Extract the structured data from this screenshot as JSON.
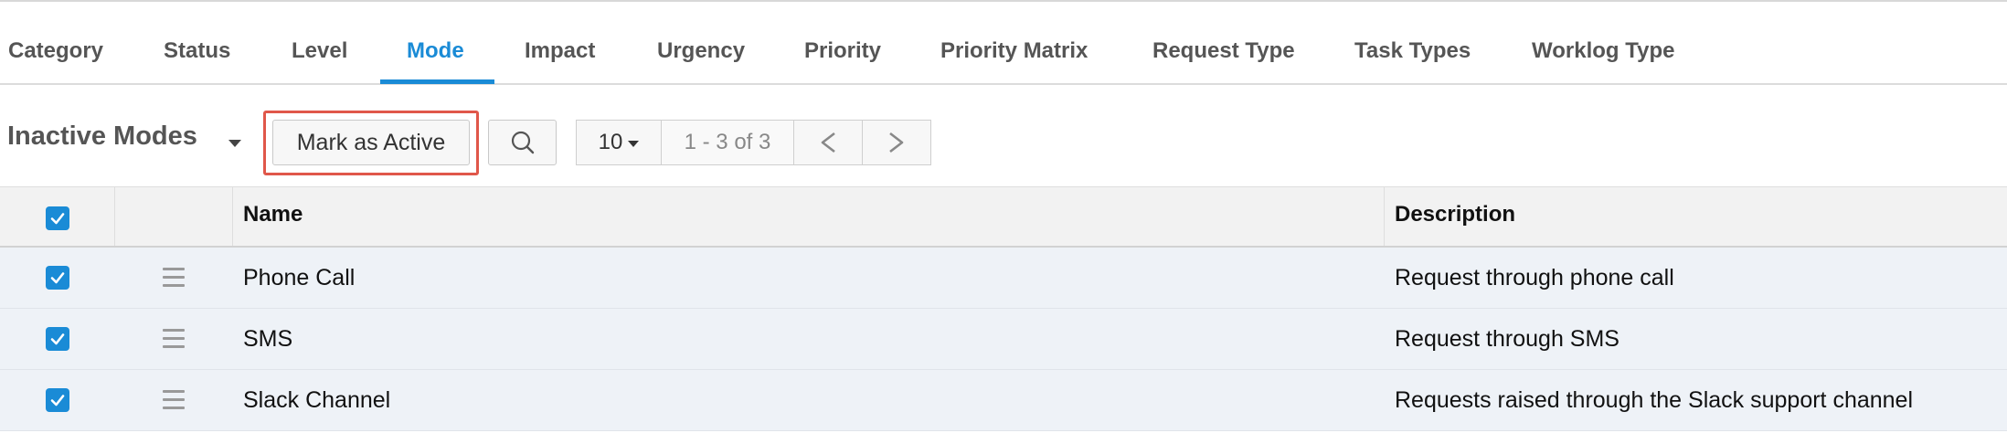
{
  "tabs": [
    {
      "label": "Category"
    },
    {
      "label": "Status"
    },
    {
      "label": "Level"
    },
    {
      "label": "Mode"
    },
    {
      "label": "Impact"
    },
    {
      "label": "Urgency"
    },
    {
      "label": "Priority"
    },
    {
      "label": "Priority Matrix"
    },
    {
      "label": "Request Type"
    },
    {
      "label": "Task Types"
    },
    {
      "label": "Worklog Type"
    }
  ],
  "active_tab": "Mode",
  "toolbar": {
    "view_title": "Inactive Modes",
    "mark_active_label": "Mark as Active",
    "search_icon": "search-icon",
    "page_size": "10",
    "page_info": "1 - 3 of 3",
    "prev_icon": "chevron-left-icon",
    "next_icon": "chevron-right-icon"
  },
  "table": {
    "headers": {
      "name": "Name",
      "description": "Description"
    },
    "select_all_checked": true,
    "rows": [
      {
        "name": "Phone Call",
        "description": "Request through phone call",
        "checked": true
      },
      {
        "name": "SMS",
        "description": "Request through SMS",
        "checked": true
      },
      {
        "name": "Slack Channel",
        "description": "Requests raised through the Slack support channel",
        "checked": true
      }
    ]
  },
  "colors": {
    "accent": "#1a8bd6",
    "highlight": "#e0574a"
  }
}
